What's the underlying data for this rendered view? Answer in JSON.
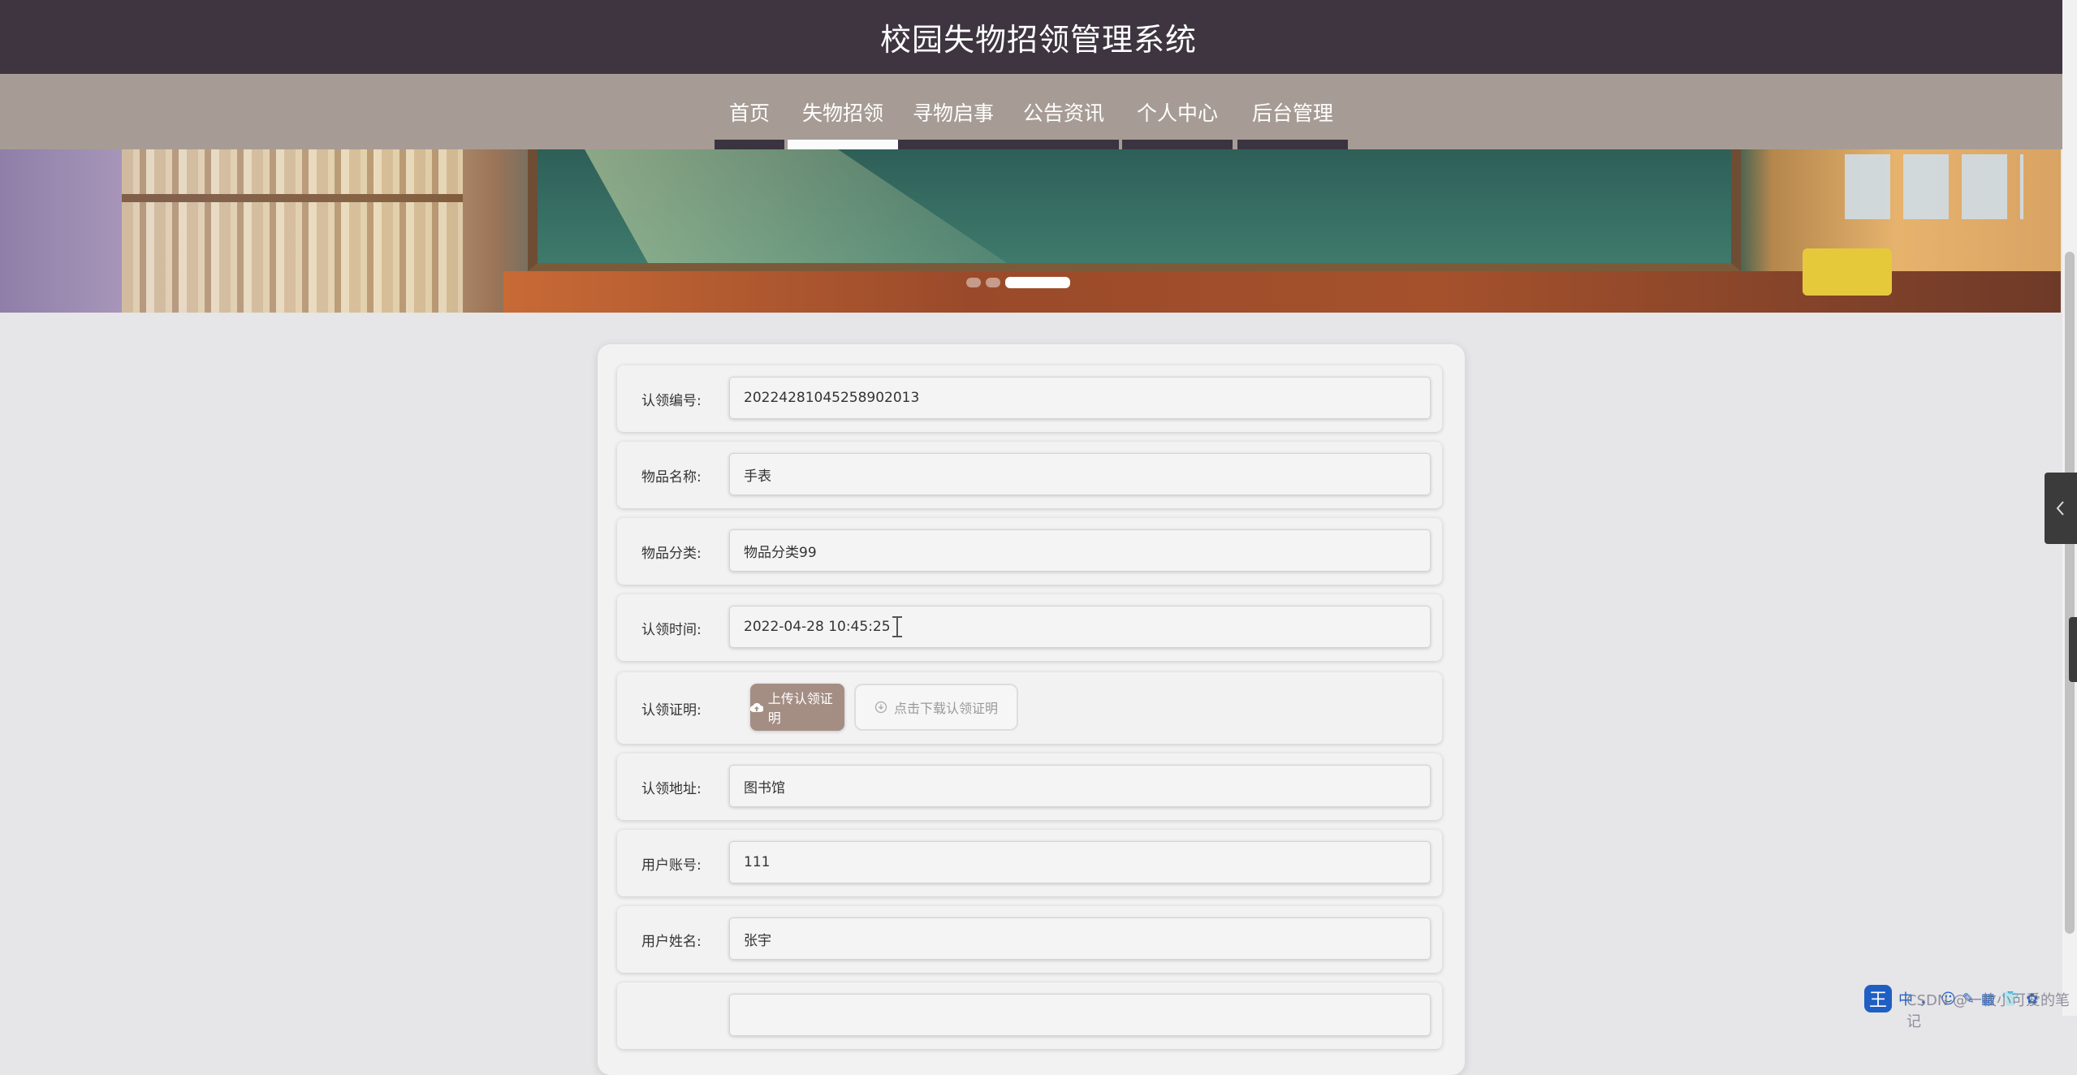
{
  "header": {
    "title": "校园失物招领管理系统"
  },
  "nav": {
    "items": [
      {
        "label": "首页",
        "active": false
      },
      {
        "label": "失物招领",
        "active": true
      },
      {
        "label": "寻物启事",
        "active": false
      },
      {
        "label": "公告资讯",
        "active": false
      },
      {
        "label": "个人中心",
        "active": false
      },
      {
        "label": "后台管理",
        "active": false
      }
    ]
  },
  "carousel": {
    "slide_count": 3,
    "active_slide": 2
  },
  "form": {
    "claim_no": {
      "label": "认领编号:",
      "value": "20224281045258902013"
    },
    "item_name": {
      "label": "物品名称:",
      "value": "手表"
    },
    "item_category": {
      "label": "物品分类:",
      "value": "物品分类99"
    },
    "claim_time": {
      "label": "认领时间:",
      "value": "2022-04-28 10:45:25"
    },
    "claim_proof": {
      "label": "认领证明:",
      "upload_label": "上传认领证明",
      "download_label": "点击下载认领证明"
    },
    "claim_address": {
      "label": "认领地址:",
      "value": "图书馆"
    },
    "user_account": {
      "label": "用户账号:",
      "value": "111"
    },
    "user_name": {
      "label": "用户姓名:",
      "value": "张宇"
    }
  },
  "ime": {
    "logo": "王",
    "items": [
      "中",
      "，",
      "☺",
      "✎",
      "▦",
      "👕",
      "✿"
    ]
  },
  "watermark": "CSDN @一枚小可爱的笔记",
  "colors": {
    "title_bar": "#3e3541",
    "nav_bar": "#a79c95",
    "upload_button": "#a48e84",
    "page_bg": "#e6e5e7"
  }
}
